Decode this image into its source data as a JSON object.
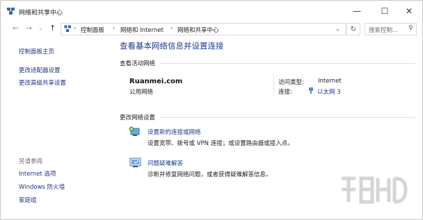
{
  "window": {
    "title": "网络和共享中心",
    "controls": {
      "minimize": "—",
      "maximize": "☐",
      "close": "✕"
    }
  },
  "address_bar": {
    "breadcrumbs": [
      "控制面板",
      "网络和 Internet",
      "网络和共享中心"
    ],
    "search_placeholder": "搜索控制..."
  },
  "sidebar": {
    "links": [
      "控制面板主页",
      "更改适配器设置",
      "更改高级共享设置"
    ],
    "see_also_label": "另请参阅",
    "see_also": [
      "Internet 选项",
      "Windows 防火墙",
      "家庭组"
    ]
  },
  "main": {
    "heading": "查看基本网络信息并设置连接",
    "active_networks_label": "查看活动网络",
    "network": {
      "name": "Ruanmei.com",
      "type": "公用网络",
      "access_type_label": "访问类型:",
      "access_type_value": "Internet",
      "connection_label": "连接:",
      "connection_value": "以太网 3"
    },
    "change_settings_label": "更改网络设置",
    "tasks": [
      {
        "title": "设置新的连接或网络",
        "desc": "设置宽带、拨号或 VPN 连接；或设置路由器或接入点。"
      },
      {
        "title": "问题疑难解答",
        "desc": "诊断并修复网络问题，或者获得疑难解答信息。"
      }
    ]
  },
  "colors": {
    "link": "#1e3a8a",
    "text": "#1e1e1e",
    "border": "#d9d9d9"
  }
}
